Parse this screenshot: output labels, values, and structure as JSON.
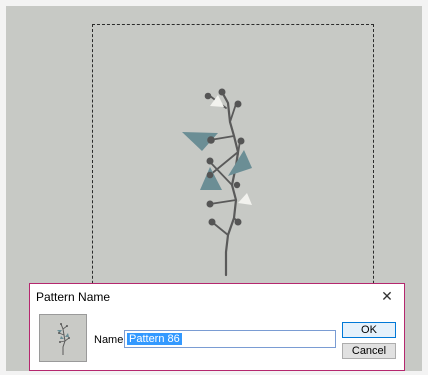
{
  "dialog": {
    "title": "Pattern Name",
    "close_glyph": "✕",
    "name_label": "Name:",
    "name_value": "Pattern 86",
    "ok_label": "OK",
    "cancel_label": "Cancel"
  },
  "colors": {
    "canvas": "#c7c9c5",
    "stem": "#5a5a5a",
    "leaf": "#6b8e95",
    "accent": "#f2f2ee",
    "dialog_border": "#b5276e",
    "selection": "#3399ff"
  },
  "icons": {
    "close": "close-icon",
    "thumbnail": "pattern-thumbnail"
  }
}
